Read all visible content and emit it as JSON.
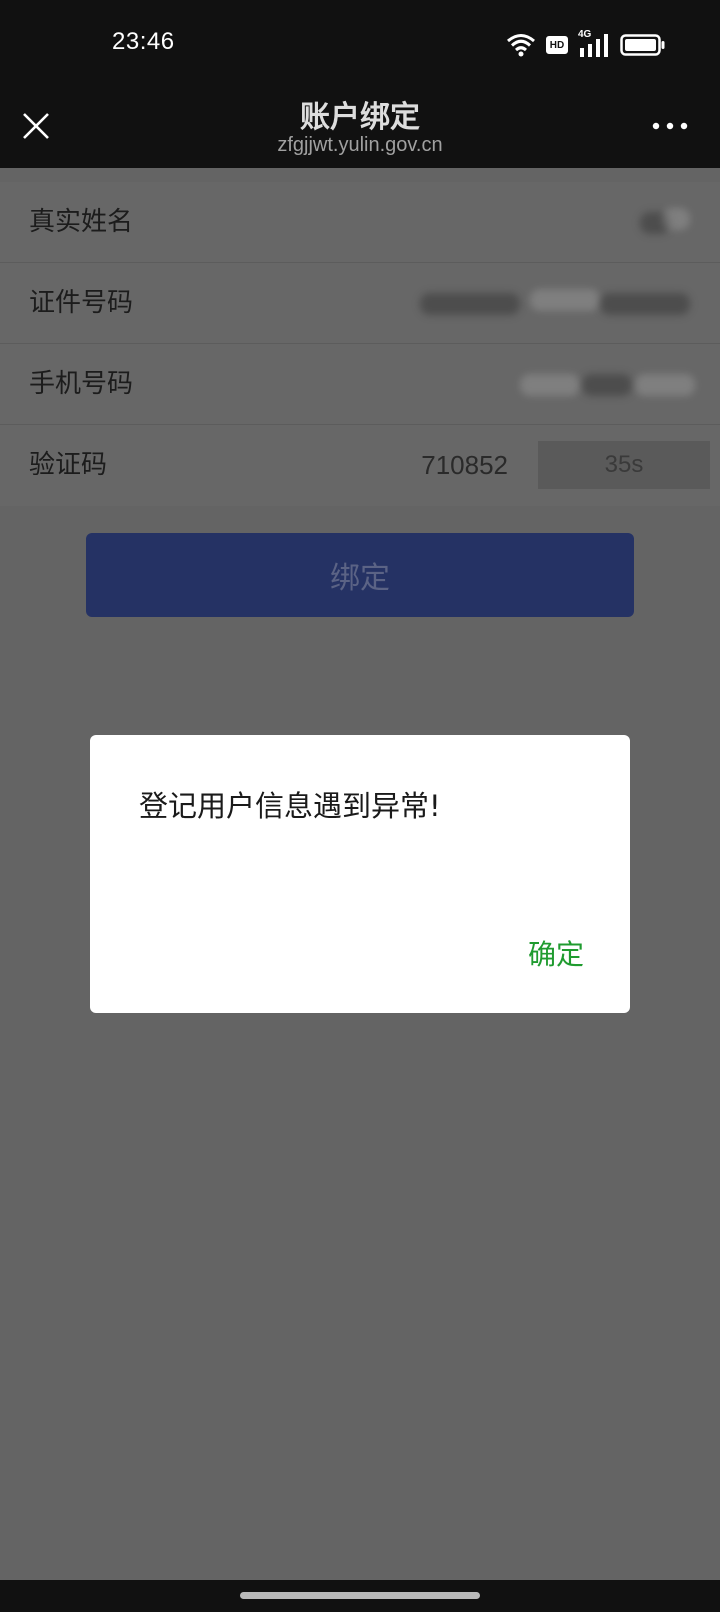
{
  "status_bar": {
    "time": "23:46",
    "icons": [
      "wifi-icon",
      "hd-icon",
      "signal-4g-icon",
      "battery-icon"
    ],
    "hd_label": "HD",
    "network_label": "4G"
  },
  "nav": {
    "title": "账户绑定",
    "subtitle": "zfgjjwt.yulin.gov.cn",
    "close_icon": "close-icon",
    "more_icon": "more-icon"
  },
  "form": {
    "name_label": "真实姓名",
    "id_label": "证件号码",
    "phone_label": "手机号码",
    "code_label": "验证码",
    "code_value": "710852",
    "countdown": "35s"
  },
  "bind_button": {
    "label": "绑定"
  },
  "dialog": {
    "message": "登记用户信息遇到异常!",
    "confirm_label": "确定"
  },
  "colors": {
    "overlay": "#646464",
    "bar": "#111111",
    "bind_button": "#253264",
    "confirm": "#1f9b2f"
  }
}
